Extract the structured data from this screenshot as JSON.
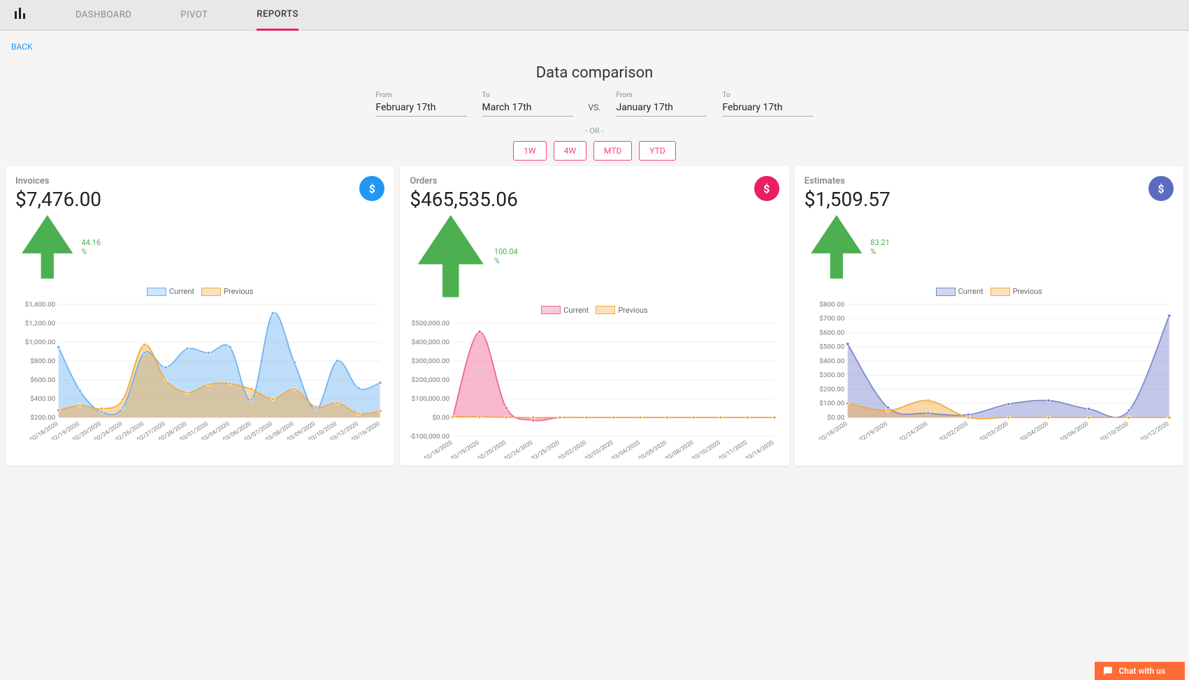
{
  "nav": {
    "tabs": [
      "DASHBOARD",
      "PIVOT",
      "REPORTS"
    ],
    "active": 2,
    "back": "BACK"
  },
  "page_title": "Data comparison",
  "date_picker": {
    "left": {
      "from_label": "From",
      "from_value": "February 17th",
      "to_label": "To",
      "to_value": "March 17th"
    },
    "right": {
      "from_label": "From",
      "from_value": "January 17th",
      "to_label": "To",
      "to_value": "February 17th"
    },
    "vs": "VS.",
    "or": "- OR -",
    "quick": [
      "1W",
      "4W",
      "MTD",
      "YTD"
    ]
  },
  "legend": {
    "current": "Current",
    "previous": "Previous"
  },
  "cards": [
    {
      "title": "Invoices",
      "amount": "$7,476.00",
      "delta": "44.16 %",
      "fab": "blue"
    },
    {
      "title": "Orders",
      "amount": "$465,535.06",
      "delta": "100.04 %",
      "fab": "pink"
    },
    {
      "title": "Estimates",
      "amount": "$1,509.57",
      "delta": "83.21 %",
      "fab": "purple"
    }
  ],
  "chat": "Chat with us",
  "chart_data": [
    {
      "type": "area",
      "title": "Invoices",
      "ylabel": "",
      "ylim": [
        0,
        1400
      ],
      "y_ticks": [
        "$200.00",
        "$400.00",
        "$600.00",
        "$800.00",
        "$1,000.00",
        "$1,200.00",
        "$1,400.00"
      ],
      "categories": [
        "02/18/2020",
        "02/19/2020",
        "02/20/2020",
        "02/24/2020",
        "02/26/2020",
        "02/27/2020",
        "02/28/2020",
        "03/01/2020",
        "03/04/2020",
        "03/06/2020",
        "03/07/2020",
        "03/08/2020",
        "03/09/2020",
        "03/10/2020",
        "03/12/2020",
        "03/16/2020"
      ],
      "series": [
        {
          "name": "Current",
          "color": "#6fb3f2",
          "values": [
            870,
            330,
            70,
            120,
            800,
            620,
            850,
            800,
            870,
            220,
            1290,
            680,
            100,
            700,
            360,
            430
          ]
        },
        {
          "name": "Previous",
          "color": "#f2a93b",
          "values": [
            90,
            150,
            110,
            220,
            900,
            460,
            310,
            410,
            420,
            350,
            230,
            350,
            130,
            180,
            50,
            80
          ]
        }
      ]
    },
    {
      "type": "area",
      "title": "Orders",
      "ylabel": "",
      "ylim": [
        -100000,
        500000
      ],
      "y_ticks": [
        "-$100,000.00",
        "$0.00",
        "$100,000.00",
        "$200,000.00",
        "$300,000.00",
        "$400,000.00",
        "$500,000.00"
      ],
      "categories": [
        "02/18/2020",
        "02/19/2020",
        "02/20/2020",
        "02/24/2020",
        "02/25/2020",
        "03/02/2020",
        "03/03/2020",
        "03/04/2020",
        "03/05/2020",
        "03/08/2020",
        "03/10/2020",
        "03/11/2020",
        "03/14/2020"
      ],
      "series": [
        {
          "name": "Current",
          "color": "#f06292",
          "values": [
            0,
            455000,
            50000,
            -15000,
            300,
            300,
            300,
            300,
            300,
            300,
            300,
            300,
            300
          ]
        },
        {
          "name": "Previous",
          "color": "#f2a93b",
          "values": [
            5000,
            3000,
            1000,
            0,
            0,
            0,
            0,
            0,
            0,
            0,
            0,
            0,
            0
          ]
        }
      ]
    },
    {
      "type": "area",
      "title": "Estimates",
      "ylabel": "",
      "ylim": [
        0,
        800
      ],
      "y_ticks": [
        "$0.00",
        "$100.00",
        "$200.00",
        "$300.00",
        "$400.00",
        "$500.00",
        "$600.00",
        "$700.00",
        "$800.00"
      ],
      "categories": [
        "02/18/2020",
        "02/19/2020",
        "02/24/2020",
        "03/02/2020",
        "03/03/2020",
        "03/04/2020",
        "03/06/2020",
        "03/10/2020",
        "03/12/2020"
      ],
      "series": [
        {
          "name": "Current",
          "color": "#7986cb",
          "values": [
            520,
            70,
            30,
            20,
            95,
            120,
            60,
            50,
            720
          ]
        },
        {
          "name": "Previous",
          "color": "#f2a93b",
          "values": [
            100,
            50,
            120,
            0,
            0,
            0,
            0,
            0,
            0
          ]
        }
      ]
    }
  ]
}
